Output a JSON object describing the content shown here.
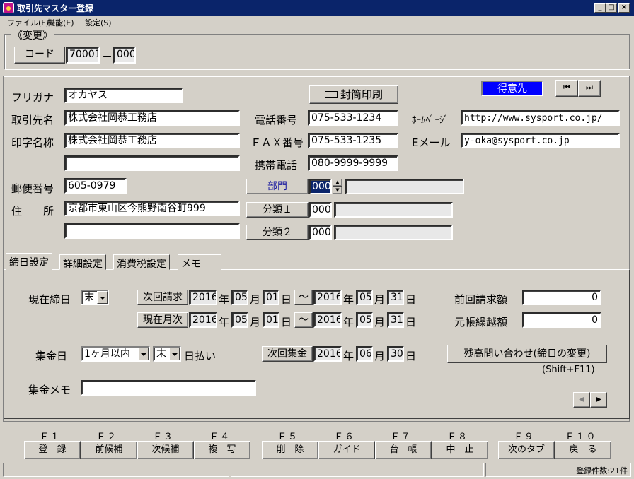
{
  "window": {
    "title": "取引先マスター登録",
    "min": "_",
    "max": "□",
    "close": "×"
  },
  "menu": [
    "ファイル(F)",
    "機能(E)",
    "設定(S)"
  ],
  "change_group": {
    "legend": "《変更》",
    "code_label": "コード",
    "code": "70001",
    "dash": "－",
    "code_sub": "000"
  },
  "customer_type": {
    "label": "得意先",
    "color": "#0000ff"
  },
  "nav": {
    "first": "⏮",
    "last": "⏭"
  },
  "envelope_button": "封筒印刷",
  "form": {
    "furigana_label": "フリガナ",
    "furigana": "オカヤス",
    "name_label": "取引先名",
    "name": "株式会社岡恭工務店",
    "print_label": "印字名称",
    "print_name": "株式会社岡恭工務店",
    "print_name2": "",
    "zip_label": "郵便番号",
    "zip": "605-0979",
    "addr_label": "住　　所",
    "addr1": "京都市東山区今熊野南谷町999",
    "addr2": "",
    "tel_label": "電話番号",
    "tel": "075-533-1234",
    "fax_label": "ＦＡＸ番号",
    "fax": "075-533-1235",
    "mobile_label": "携帯電話",
    "mobile": "080-9999-9999",
    "hp_label": "ﾎｰﾑﾍﾟｰｼﾞ",
    "hp": "http://www.sysport.co.jp/",
    "email_label": "Eメール",
    "email": "y-oka@sysport.co.jp",
    "dept_button": "部門",
    "dept_code": "000",
    "dept_name": "",
    "cat1_button": "分類１",
    "cat1_code": "000",
    "cat1_name": "",
    "cat2_button": "分類２",
    "cat2_code": "000",
    "cat2_name": ""
  },
  "tabs": [
    "締日設定",
    "詳細設定",
    "消費税設定",
    "メモ"
  ],
  "closing": {
    "current_label": "現在締日",
    "current": "末",
    "next_invoice_btn": "次回請求",
    "month_btn": "現在月次",
    "inv_from": {
      "y": "2016",
      "m": "05",
      "d": "01"
    },
    "inv_to": {
      "y": "2016",
      "m": "05",
      "d": "31"
    },
    "mon_from": {
      "y": "2016",
      "m": "05",
      "d": "01"
    },
    "mon_to": {
      "y": "2016",
      "m": "05",
      "d": "31"
    },
    "nen": "年",
    "gatsu": "月",
    "nichi": "日",
    "tilde": "～",
    "prev_invoice_label": "前回請求額",
    "prev_invoice": "0",
    "carry_label": "元帳繰越額",
    "carry": "0",
    "collect_label": "集金日",
    "collect_month": "1ヶ月以内",
    "collect_day": "末",
    "collect_suffix": "日払い",
    "next_collect_btn": "次回集金",
    "next_collect": {
      "y": "2016",
      "m": "06",
      "d": "30"
    },
    "balance_btn": "残高問い合わせ(締日の変更)",
    "balance_hint": "(Shift+F11)",
    "memo_label": "集金メモ",
    "memo": "",
    "scroll_left": "◀",
    "scroll_right": "▶"
  },
  "fkeys": [
    {
      "key": "Ｆ１",
      "label": "登　録"
    },
    {
      "key": "Ｆ２",
      "label": "前候補"
    },
    {
      "key": "Ｆ３",
      "label": "次候補"
    },
    {
      "key": "Ｆ４",
      "label": "複　写"
    },
    {
      "key": "Ｆ５",
      "label": "削　除"
    },
    {
      "key": "Ｆ６",
      "label": "ガイド"
    },
    {
      "key": "Ｆ７",
      "label": "台　帳"
    },
    {
      "key": "Ｆ８",
      "label": "中　止"
    },
    {
      "key": "Ｆ９",
      "label": "次のタブ"
    },
    {
      "key": "Ｆ１０",
      "label": "戻　る"
    }
  ],
  "status": {
    "count": "登録件数:21件"
  }
}
